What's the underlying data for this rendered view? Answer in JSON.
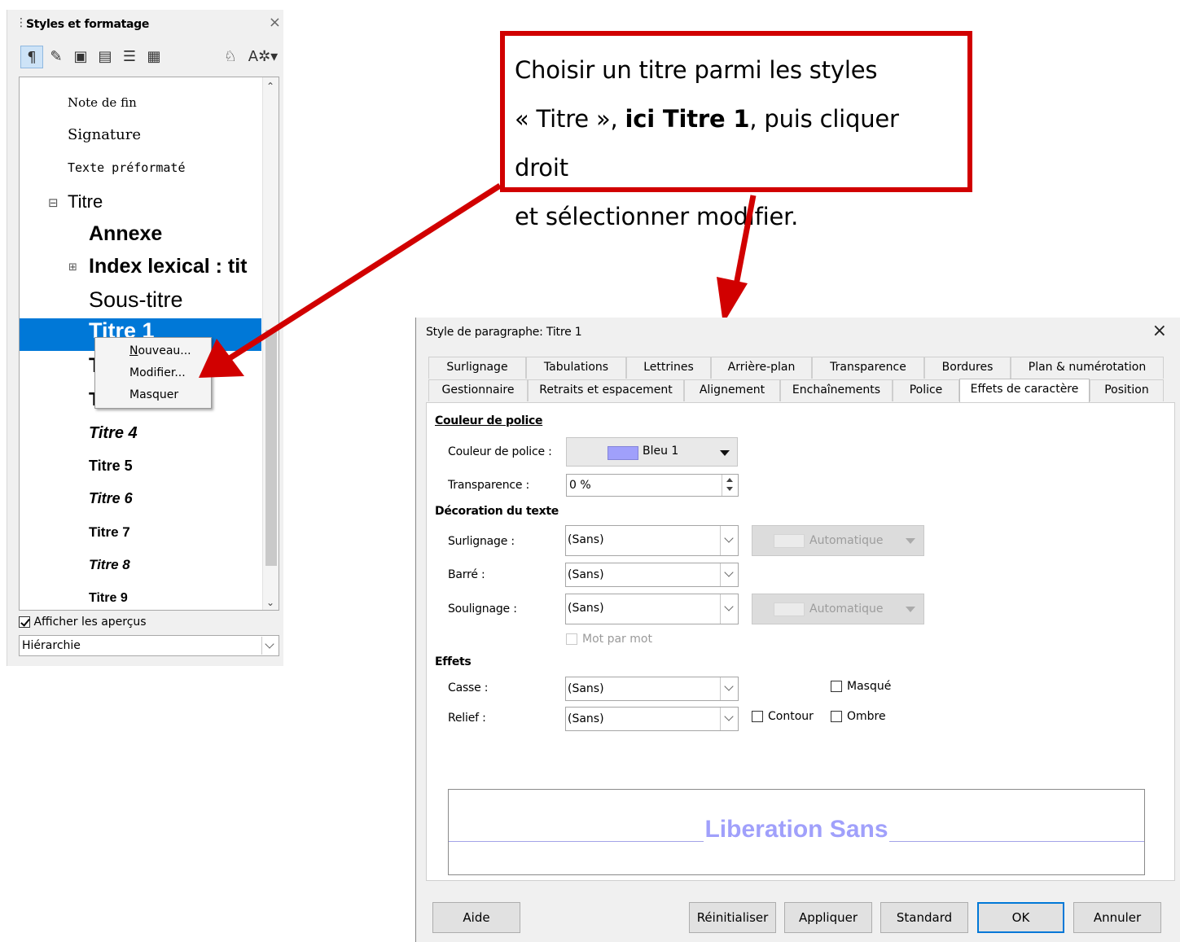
{
  "styles_panel": {
    "title": "Styles et formatage",
    "close": "×",
    "toolbar_icons": [
      "paragraph-styles-icon",
      "character-styles-icon",
      "frame-styles-icon",
      "page-styles-icon",
      "list-styles-icon",
      "table-styles-icon",
      "fill-format-icon",
      "new-style-icon"
    ],
    "list": [
      {
        "label": "Note de fin"
      },
      {
        "label": "Signature"
      },
      {
        "label": "Texte préformaté"
      },
      {
        "label": "Titre"
      },
      {
        "label": "Annexe"
      },
      {
        "label": "Index lexical : tit"
      },
      {
        "label": "Sous-titre"
      },
      {
        "label": "Titre 1",
        "selected": true
      },
      {
        "label": "T"
      },
      {
        "label": "T"
      },
      {
        "label": "Titre 4"
      },
      {
        "label": "Titre 5"
      },
      {
        "label": "Titre 6"
      },
      {
        "label": "Titre 7"
      },
      {
        "label": "Titre 8"
      },
      {
        "label": "Titre 9"
      }
    ],
    "show_previews_label": "Afficher les aperçus",
    "show_previews_checked": true,
    "filter_value": "Hiérarchie",
    "selection_color": "#0078d7"
  },
  "context_menu": {
    "items": [
      {
        "label": "Nouveau..."
      },
      {
        "label": "Modifier..."
      },
      {
        "label": "Masquer"
      }
    ]
  },
  "callout": {
    "line1": "Choisir un titre parmi les styles",
    "line2_a": "« Titre », ",
    "line2_b": "ici Titre 1",
    "line2_c": ", puis cliquer droit",
    "line3": "et sélectionner modifier.",
    "border_color": "#d10000"
  },
  "dialog": {
    "title": "Style de paragraphe: Titre 1",
    "close": "×",
    "tabs_row1": [
      "Surlignage",
      "Tabulations",
      "Lettrines",
      "Arrière-plan",
      "Transparence",
      "Bordures",
      "Plan & numérotation"
    ],
    "tabs_row2": [
      "Gestionnaire",
      "Retraits et espacement",
      "Alignement",
      "Enchaînements",
      "Police",
      "Effets de caractère",
      "Position"
    ],
    "active_tab": "Effets de caractère",
    "sections": {
      "font_color": "Couleur de police",
      "decoration": "Décoration du texte",
      "effects": "Effets"
    },
    "labels": {
      "font_color": "Couleur de police :",
      "transparency": "Transparence :",
      "highlight": "Surlignage :",
      "strike": "Barré :",
      "underline": "Soulignage :",
      "case": "Casse :",
      "relief": "Relief :"
    },
    "values": {
      "font_color": "Bleu 1",
      "font_color_hex": "#a0a0fb",
      "transparency": "0 %",
      "highlight": "(Sans)",
      "strike": "(Sans)",
      "underline": "(Sans)",
      "case": "(Sans)",
      "relief": "(Sans)",
      "overline_color": "Automatique",
      "underline_color": "Automatique"
    },
    "checks": {
      "word_by_word": "Mot par mot",
      "hidden": "Masqué",
      "outline": "Contour",
      "shadow": "Ombre"
    },
    "preview_text": "Liberation Sans",
    "buttons": [
      "Aide",
      "Réinitialiser",
      "Appliquer",
      "Standard",
      "OK",
      "Annuler"
    ]
  }
}
